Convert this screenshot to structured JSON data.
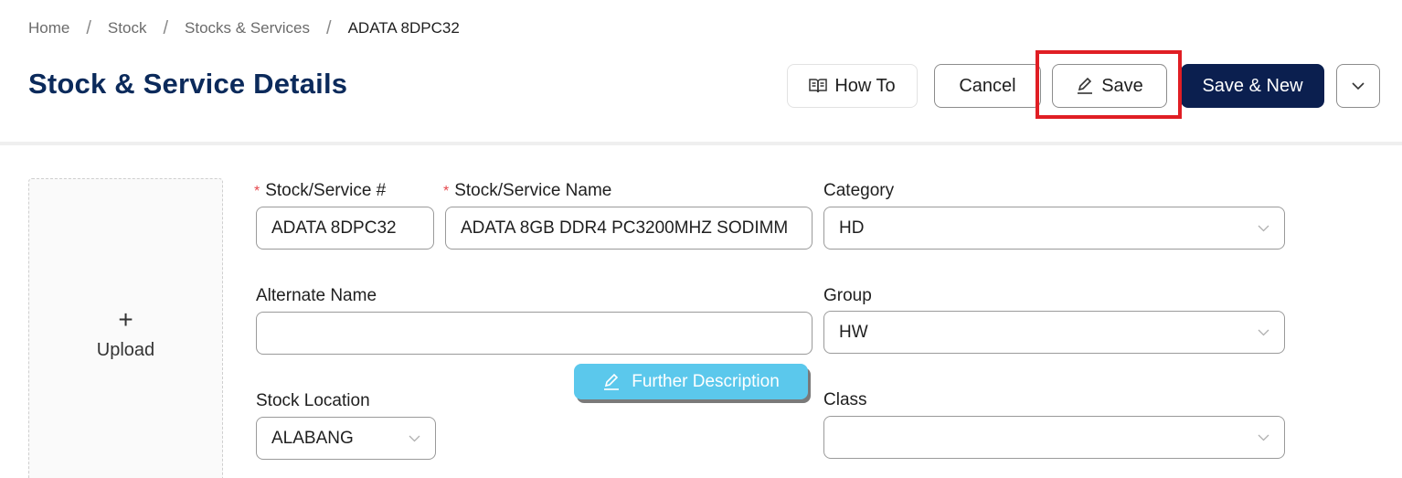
{
  "breadcrumb": {
    "home": "Home",
    "stock": "Stock",
    "stocks_services": "Stocks & Services",
    "current": "ADATA 8DPC32",
    "separator": "/"
  },
  "page_title": "Stock & Service Details",
  "toolbar": {
    "how_to": "How To",
    "cancel": "Cancel",
    "save": "Save",
    "save_new": "Save & New"
  },
  "upload": {
    "plus": "+",
    "label": "Upload"
  },
  "form": {
    "stock_number": {
      "label": "Stock/Service #",
      "value": "ADATA 8DPC32",
      "required": true
    },
    "stock_name": {
      "label": "Stock/Service Name",
      "value": "ADATA 8GB DDR4 PC3200MHZ SODIMM",
      "required": true
    },
    "category": {
      "label": "Category",
      "value": "HD"
    },
    "alternate_name": {
      "label": "Alternate Name",
      "value": ""
    },
    "group": {
      "label": "Group",
      "value": "HW"
    },
    "stock_location": {
      "label": "Stock Location",
      "value": "ALABANG"
    },
    "class": {
      "label": "Class",
      "value": ""
    },
    "required_marker": "*"
  },
  "further_description": "Further Description",
  "colors": {
    "title": "#0b2a5b",
    "primary_button": "#0b1f4f",
    "highlight": "#e01e24",
    "further_button": "#5bc8ec",
    "required": "#e5484d"
  }
}
